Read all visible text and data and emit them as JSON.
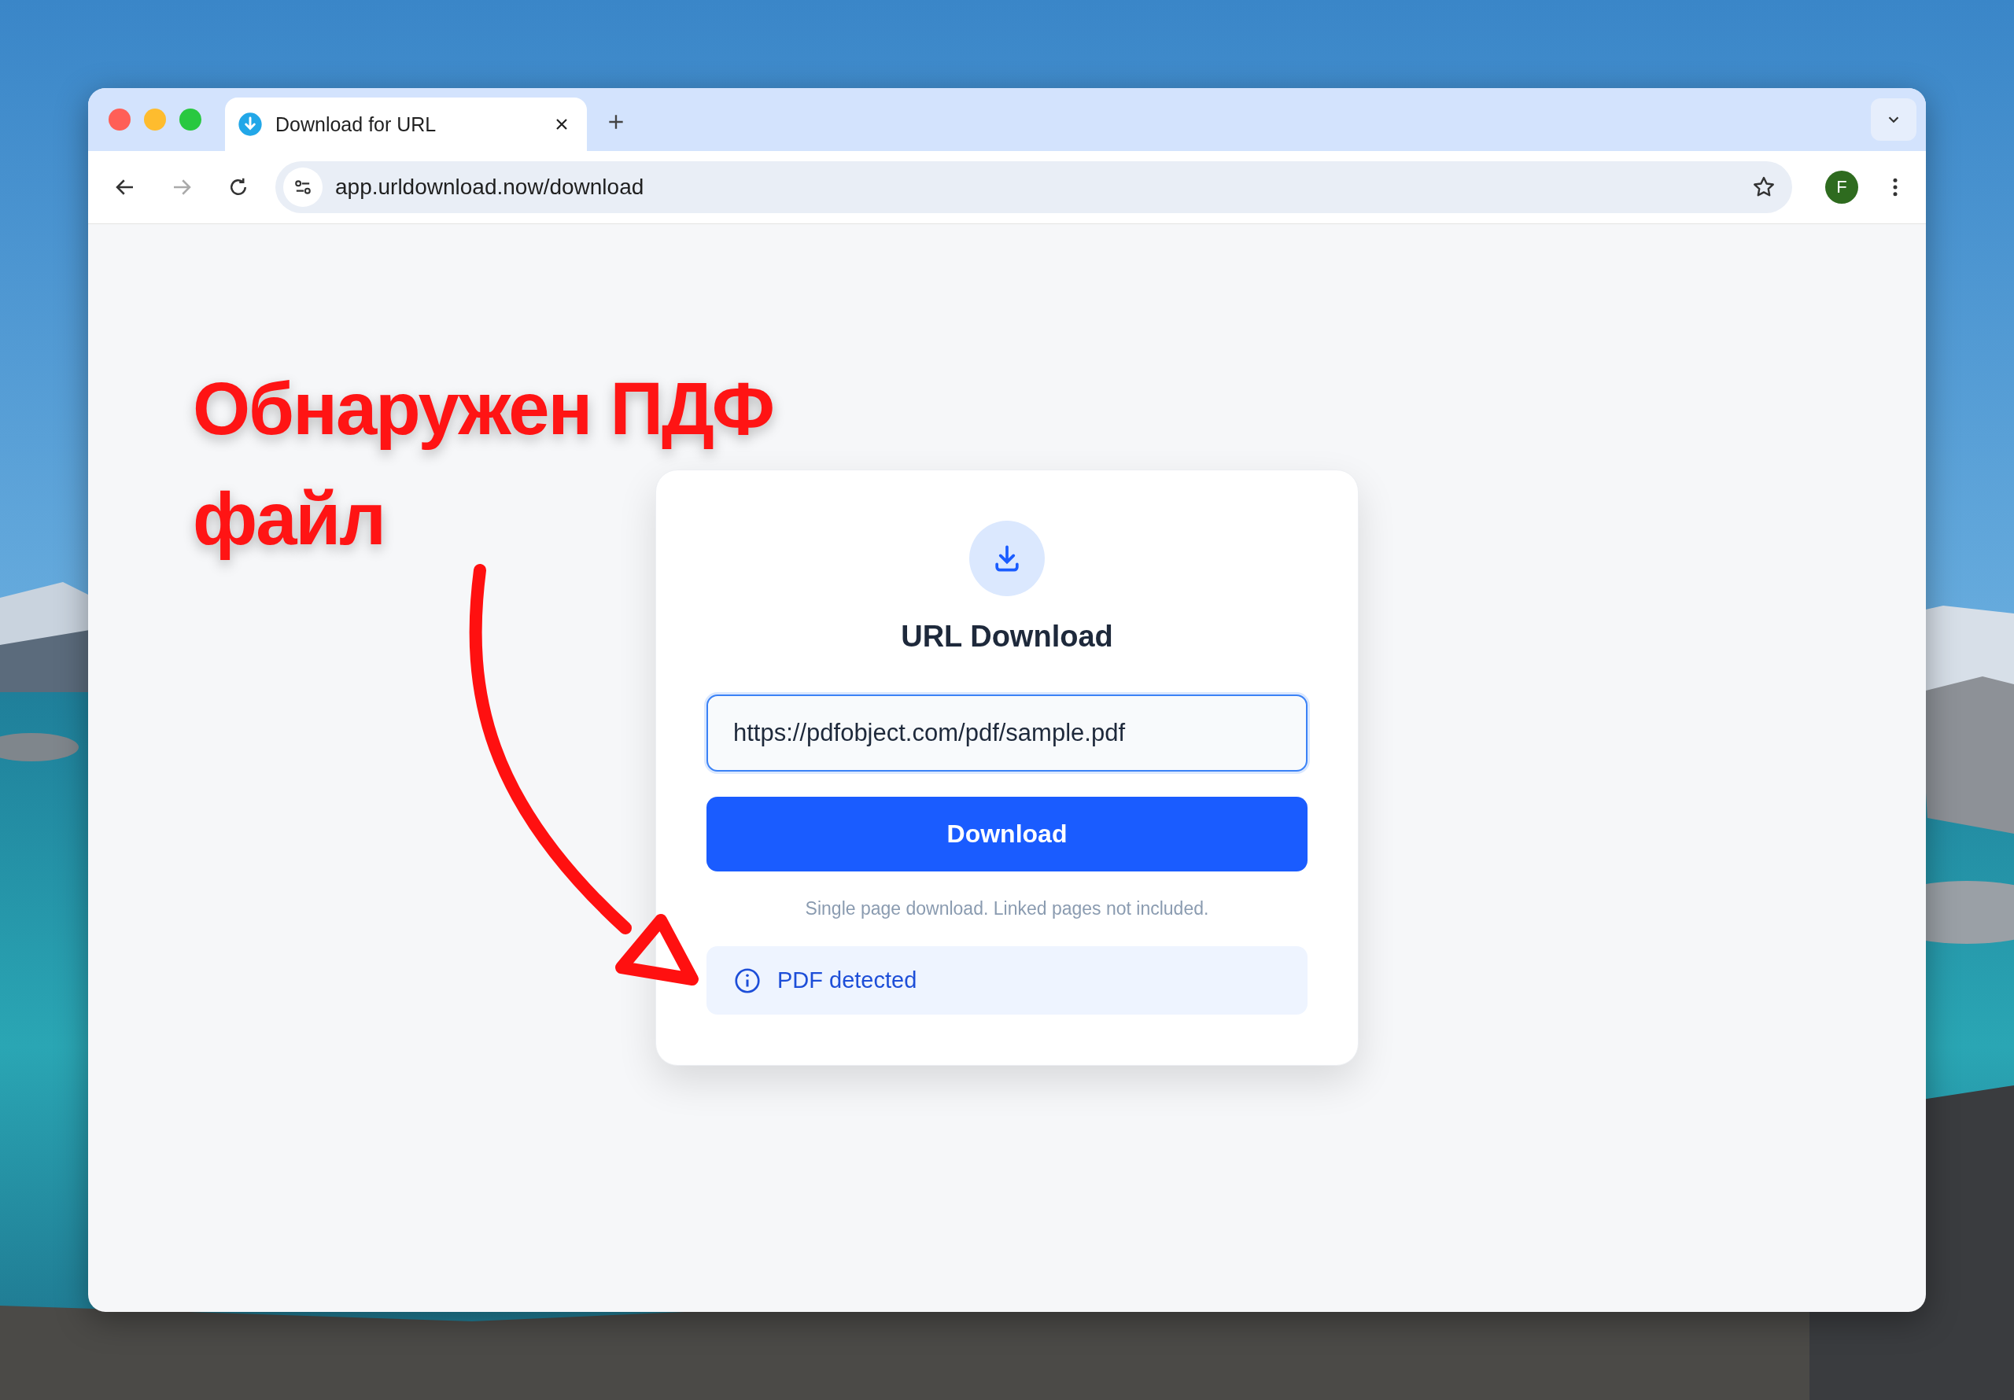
{
  "window": {
    "controls": [
      {
        "color": "#ff5f57"
      },
      {
        "color": "#febc2e"
      },
      {
        "color": "#28c840"
      }
    ]
  },
  "tabs": [
    {
      "title": "Download for URL",
      "selected": true
    }
  ],
  "toolbar": {
    "url": "app.urldownload.now/download",
    "forward_disabled": true,
    "profile_initial": "F"
  },
  "card": {
    "title": "URL Download",
    "url_value": "https://pdfobject.com/pdf/sample.pdf",
    "button": "Download",
    "hint": "Single page download. Linked pages not included.",
    "notice": "PDF detected"
  },
  "annotation": {
    "text": "Обнаружен ПДФ файл"
  }
}
